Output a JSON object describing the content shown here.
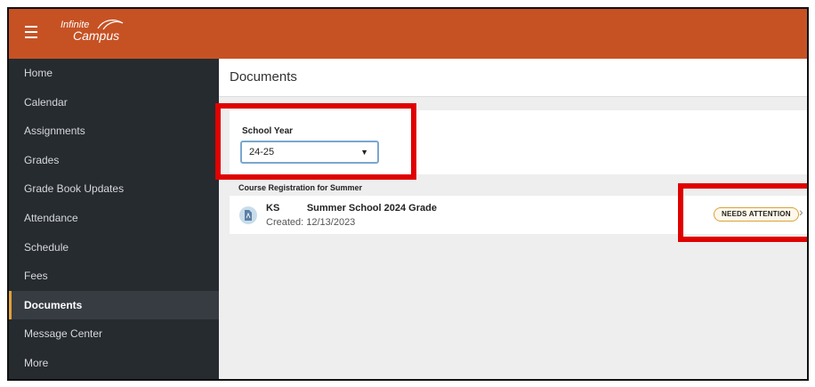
{
  "app": {
    "logo_line1": "Infinite",
    "logo_line2": "Campus"
  },
  "sidebar": {
    "items": [
      {
        "label": "Home",
        "active": false
      },
      {
        "label": "Calendar",
        "active": false
      },
      {
        "label": "Assignments",
        "active": false
      },
      {
        "label": "Grades",
        "active": false
      },
      {
        "label": "Grade Book Updates",
        "active": false
      },
      {
        "label": "Attendance",
        "active": false
      },
      {
        "label": "Schedule",
        "active": false
      },
      {
        "label": "Fees",
        "active": false
      },
      {
        "label": "Documents",
        "active": true
      },
      {
        "label": "Message Center",
        "active": false
      },
      {
        "label": "More",
        "active": false
      }
    ]
  },
  "main": {
    "title": "Documents",
    "school_year": {
      "label": "School Year",
      "value": "24-25"
    },
    "section_label": "Course Registration for Summer",
    "document": {
      "name": "KS          Summer School 2024 Grade",
      "created": "Created: 12/13/2023",
      "status": "NEEDS ATTENTION"
    }
  },
  "colors": {
    "topbar": "#c65224",
    "sidebar": "#262b30",
    "highlight": "#e00000",
    "badge_border": "#d9a33a"
  }
}
